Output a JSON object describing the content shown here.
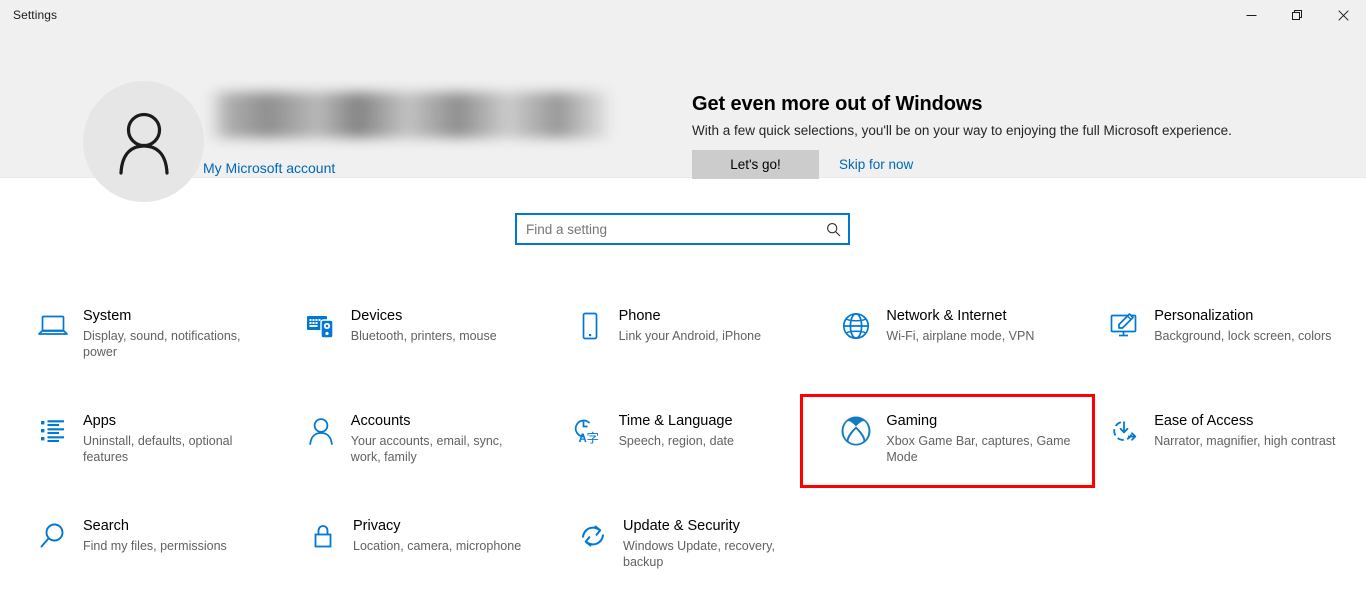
{
  "window": {
    "title": "Settings",
    "controls": [
      {
        "name": "minimize",
        "glyph": "—"
      },
      {
        "name": "maximize",
        "glyph": "❐"
      },
      {
        "name": "close",
        "glyph": "✕"
      }
    ]
  },
  "account": {
    "name_redacted": "",
    "link_label": "My Microsoft account",
    "avatar_icon": "person-icon"
  },
  "promo": {
    "title": "Get even more out of Windows",
    "subtitle": "With a few quick selections, you'll be on your way to enjoying the full Microsoft experience.",
    "primary_button": "Let's go!",
    "secondary_link": "Skip for now"
  },
  "search": {
    "placeholder": "Find a setting",
    "value": "",
    "icon": "search-icon"
  },
  "colors": {
    "accent": "#0078d4",
    "link": "#0067b8",
    "highlight": "#ff0000",
    "header_band": "#f0f0f0",
    "description_text": "#616161"
  },
  "highlight": {
    "target": "Gaming",
    "color": "#ff0000"
  },
  "tiles": [
    [
      {
        "icon": "laptop-icon",
        "title": "System",
        "desc": "Display, sound, notifications, power"
      },
      {
        "icon": "devices-icon",
        "title": "Devices",
        "desc": "Bluetooth, printers, mouse"
      },
      {
        "icon": "phone-icon",
        "title": "Phone",
        "desc": "Link your Android, iPhone"
      },
      {
        "icon": "globe-icon",
        "title": "Network & Internet",
        "desc": "Wi-Fi, airplane mode, VPN"
      },
      {
        "icon": "personalization-icon",
        "title": "Personalization",
        "desc": "Background, lock screen, colors"
      }
    ],
    [
      {
        "icon": "apps-list-icon",
        "title": "Apps",
        "desc": "Uninstall, defaults, optional features"
      },
      {
        "icon": "person-icon",
        "title": "Accounts",
        "desc": "Your accounts, email, sync, work, family"
      },
      {
        "icon": "clock-language-icon",
        "title": "Time & Language",
        "desc": "Speech, region, date"
      },
      {
        "icon": "xbox-icon",
        "title": "Gaming",
        "desc": "Xbox Game Bar, captures, Game Mode"
      },
      {
        "icon": "ease-of-access-icon",
        "title": "Ease of Access",
        "desc": "Narrator, magnifier, high contrast"
      }
    ],
    [
      {
        "icon": "search-icon",
        "title": "Search",
        "desc": "Find my files, permissions"
      },
      {
        "icon": "lock-icon",
        "title": "Privacy",
        "desc": "Location, camera, microphone"
      },
      {
        "icon": "refresh-icon",
        "title": "Update & Security",
        "desc": "Windows Update, recovery, backup"
      }
    ]
  ]
}
